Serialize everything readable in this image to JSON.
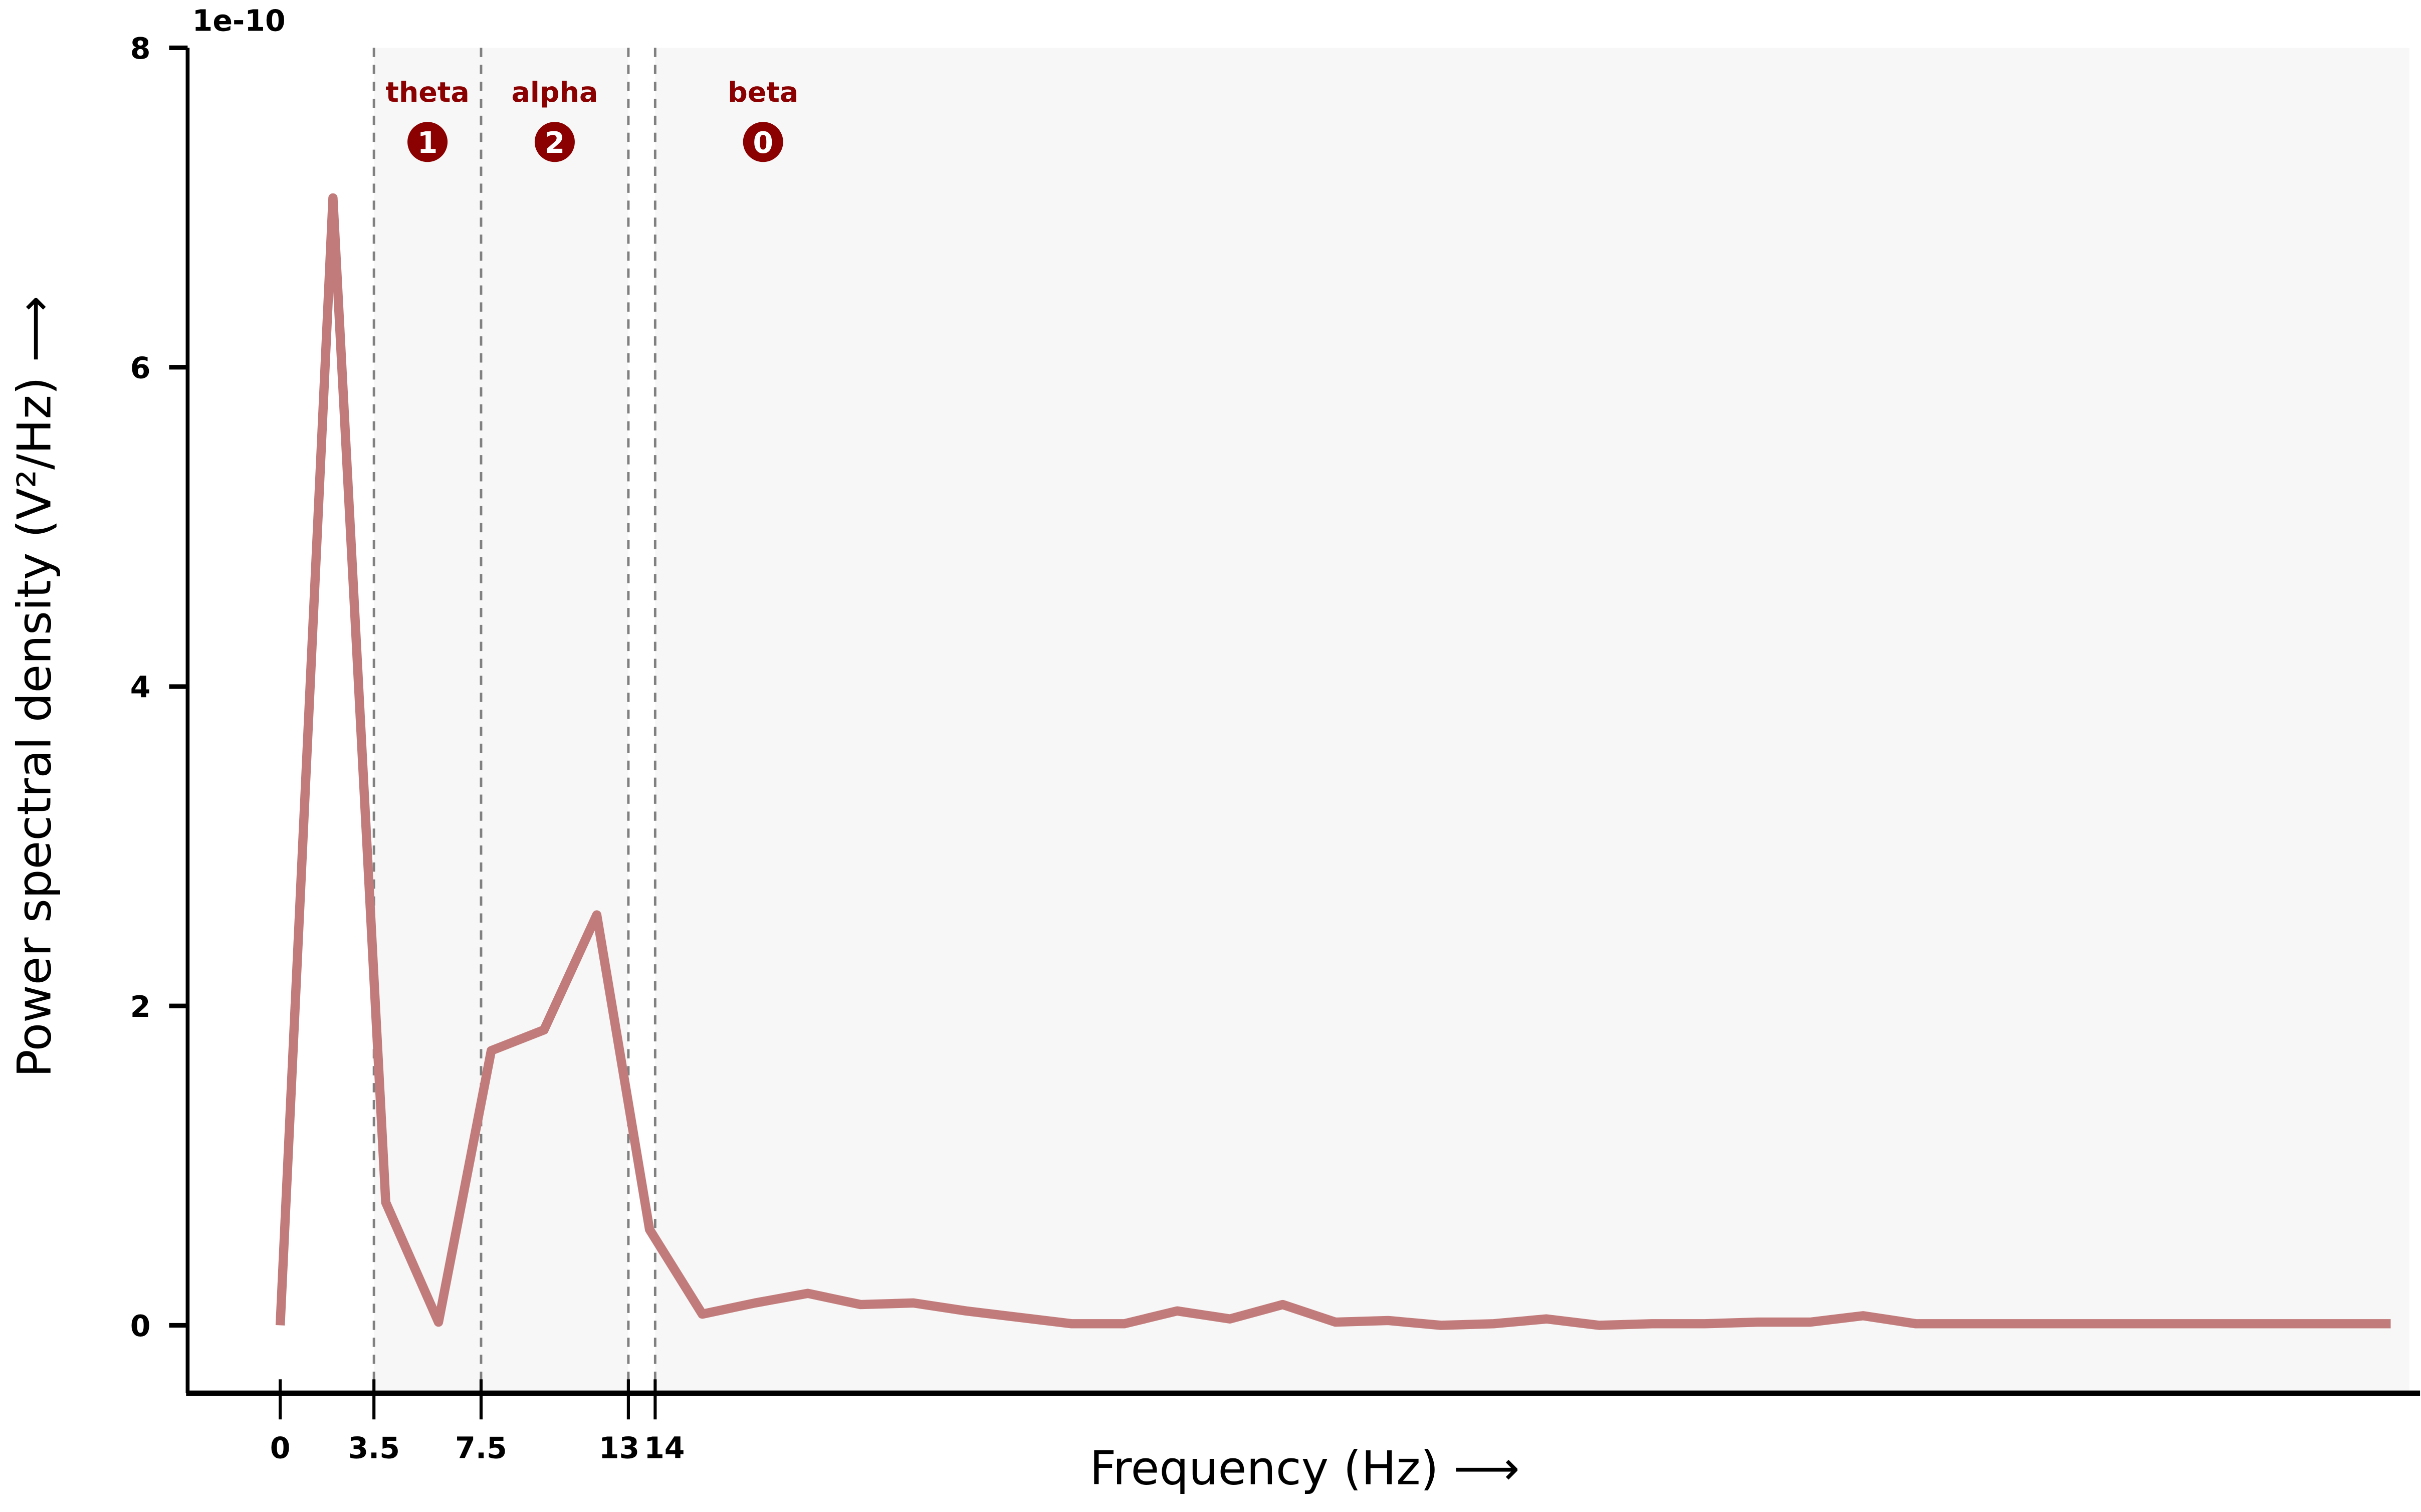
{
  "chart_data": {
    "type": "line",
    "xlabel": "Frequency (Hz) ⟶",
    "ylabel": "Power spectral density (V²/Hz) ⟶",
    "y_offset_label": "1e-10",
    "xlim": [
      -3.4,
      79.5
    ],
    "ylim": [
      -0.42,
      8
    ],
    "x_ticks": [
      0,
      3.5,
      7.5,
      13,
      14
    ],
    "x_tick_labels": [
      "0",
      "3.5",
      "7.5",
      "13",
      "14"
    ],
    "y_ticks": [
      0,
      2,
      4,
      6,
      8
    ],
    "y_tick_labels": [
      "0",
      "2",
      "4",
      "6",
      "8"
    ],
    "grid": false,
    "line_color": "#c27b7b",
    "band_shade_color": "#f7f7f7",
    "band_label_color": "#8b0000",
    "band_boundaries": [
      3.5,
      7.5,
      13,
      14
    ],
    "bands": [
      {
        "name": "theta",
        "range": [
          3.5,
          7.5
        ],
        "count": "1"
      },
      {
        "name": "alpha",
        "range": [
          7.5,
          13
        ],
        "count": "2"
      },
      {
        "name": "beta",
        "range": [
          14,
          79.5
        ],
        "count": "0"
      }
    ],
    "x": [
      0,
      1.97,
      3.94,
      5.91,
      7.88,
      9.85,
      11.82,
      13.79,
      15.76,
      17.73,
      19.7,
      21.67,
      23.64,
      25.61,
      27.58,
      29.55,
      31.52,
      33.49,
      35.46,
      37.43,
      39.4,
      41.37,
      43.34,
      45.31,
      47.28,
      49.25,
      51.22,
      53.19,
      55.16,
      57.13,
      59.1,
      61.07,
      63.04,
      65.01,
      66.98,
      68.95,
      70.92,
      72.89,
      74.86,
      76.83,
      78.8
    ],
    "y": [
      0,
      7.06,
      0.77,
      0.02,
      1.72,
      1.85,
      2.57,
      0.6,
      0.07,
      0.14,
      0.2,
      0.13,
      0.14,
      0.09,
      0.05,
      0.01,
      0.01,
      0.09,
      0.04,
      0.13,
      0.02,
      0.03,
      0.0,
      0.01,
      0.04,
      0.0,
      0.01,
      0.01,
      0.02,
      0.02,
      0.06,
      0.01,
      0.01,
      0.01,
      0.01,
      0.01,
      0.01,
      0.01,
      0.01,
      0.01,
      0.01
    ]
  }
}
